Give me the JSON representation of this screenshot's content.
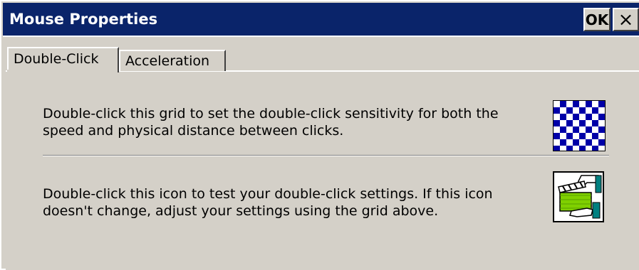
{
  "window": {
    "title": "Mouse Properties",
    "ok_label": "OK",
    "close_label": "×"
  },
  "tabs": [
    {
      "label": "Double-Click",
      "active": true
    },
    {
      "label": "Acceleration",
      "active": false
    }
  ],
  "double_click": {
    "grid_text": "Double-click this grid to set the double-click sensitivity for both the speed and physical distance between clicks.",
    "test_text": "Double-click this icon to test your double-click settings. If this icon doesn't change, adjust your settings using the grid above.",
    "grid_icon": "checkerboard-grid-icon",
    "test_icon": "clapperboard-test-icon"
  },
  "colors": {
    "titlebar": "#0a246a",
    "face": "#d4d0c8",
    "grid_blue": "#0000a8",
    "icon_green": "#7fd000",
    "icon_teal": "#008080"
  }
}
